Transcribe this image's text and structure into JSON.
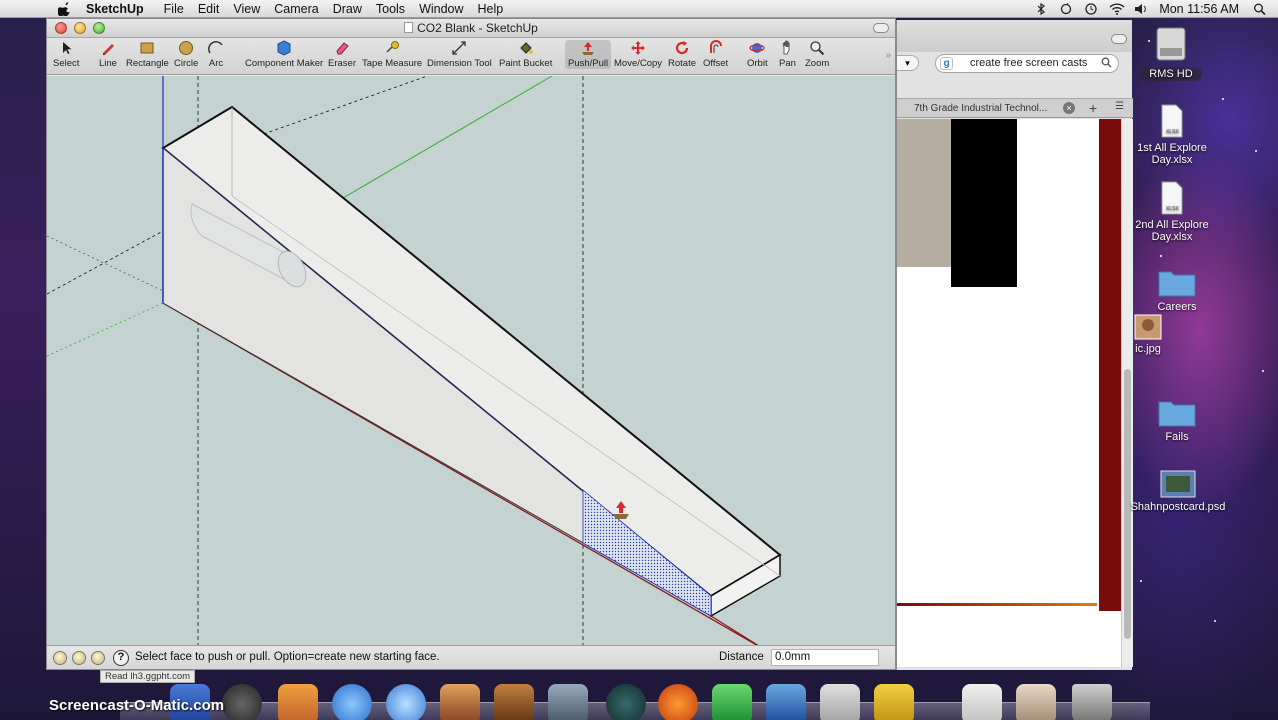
{
  "menubar": {
    "app_name": "SketchUp",
    "items": [
      "File",
      "Edit",
      "View",
      "Camera",
      "Draw",
      "Tools",
      "Window",
      "Help"
    ],
    "clock": "Mon 11:56 AM"
  },
  "sketchup": {
    "title": "CO2 Blank - SketchUp",
    "tools": [
      {
        "label": "Select",
        "icon": "select-arrow-icon"
      },
      {
        "label": "Line",
        "icon": "pencil-icon"
      },
      {
        "label": "Rectangle",
        "icon": "rectangle-icon"
      },
      {
        "label": "Circle",
        "icon": "circle-icon"
      },
      {
        "label": "Arc",
        "icon": "arc-icon"
      },
      {
        "label": "Component Maker",
        "icon": "component-icon"
      },
      {
        "label": "Eraser",
        "icon": "eraser-icon"
      },
      {
        "label": "Tape Measure",
        "icon": "tape-measure-icon"
      },
      {
        "label": "Dimension Tool",
        "icon": "dimension-icon"
      },
      {
        "label": "Paint Bucket",
        "icon": "paint-bucket-icon"
      },
      {
        "label": "Push/Pull",
        "icon": "push-pull-icon"
      },
      {
        "label": "Move/Copy",
        "icon": "move-icon"
      },
      {
        "label": "Rotate",
        "icon": "rotate-icon"
      },
      {
        "label": "Offset",
        "icon": "offset-icon"
      },
      {
        "label": "Orbit",
        "icon": "orbit-icon"
      },
      {
        "label": "Pan",
        "icon": "hand-icon"
      },
      {
        "label": "Zoom",
        "icon": "magnifier-icon"
      }
    ],
    "active_tool": "Push/Pull",
    "status_text": "Select face to push or pull. Option=create new starting face.",
    "distance_label": "Distance",
    "distance_value": "0.0mm"
  },
  "browser": {
    "search_text": "create free screen casts",
    "tab_title": "7th Grade Industrial Technol...",
    "status_url": "Read lh3.ggpht.com"
  },
  "desktop_icons": [
    {
      "label": "RMS HD",
      "icon": "hard-drive-icon"
    },
    {
      "label_line1": "1st All Explore",
      "label_line2": "Day.xlsx",
      "icon": "xlsx-file-icon"
    },
    {
      "label_line1": "2nd All Explore",
      "label_line2": "Day.xlsx",
      "icon": "xlsx-file-icon"
    },
    {
      "label": "Careers",
      "icon": "folder-icon"
    },
    {
      "label": "ic.jpg",
      "icon": "image-file-icon"
    },
    {
      "label": "Fails",
      "icon": "folder-icon"
    },
    {
      "label": "Shahnpostcard.psd",
      "icon": "psd-file-icon"
    }
  ],
  "watermark": "Screencast-O-Matic.com",
  "colors": {
    "viewport_bg": "#c4d2d1",
    "red_axis": "#8b1a1a",
    "green_axis": "#2fae2f",
    "blue_axis": "#1f2fbf"
  }
}
